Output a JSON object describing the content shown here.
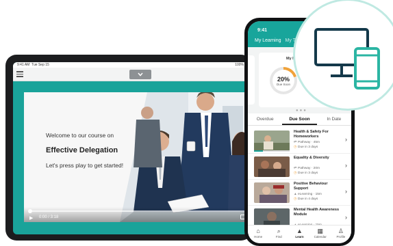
{
  "tablet": {
    "status_time": "9:41 AM",
    "status_date": "Tue Sep 15",
    "status_battery": "100%",
    "collapse_icon": "chevron-down-icon",
    "video": {
      "welcome": "Welcome to our course on",
      "course_title": "Effective Delegation",
      "cta": "Let's press play to get started!",
      "time": "0:00 / 3:18",
      "progress_fraction": 0
    }
  },
  "phone": {
    "status_time": "9:41",
    "tabs": {
      "active": "My Learning",
      "partial": "My T"
    },
    "progress_card": {
      "title": "My Mo",
      "percent": "20%",
      "label": "Due Soon"
    },
    "filter_tabs": [
      {
        "label": "Overdue",
        "active": false
      },
      {
        "label": "Due Soon",
        "active": true
      },
      {
        "label": "In Date",
        "active": false
      }
    ],
    "courses": [
      {
        "title": "Health & Safety For Homeworkers",
        "type": "Pathway · 45m",
        "due": "Due in 3 days",
        "progress": 0.25
      },
      {
        "title": "Equality & Diversity",
        "type": "Pathway · 20m",
        "due": "Due in 3 days",
        "progress": 0
      },
      {
        "title": "Positive Behaviour Support",
        "type": "eLearning · 15m",
        "due": "Due in 4 days",
        "progress": 0
      },
      {
        "title": "Mental Health Awareness Module",
        "type": "eLearning · 15m",
        "due": "",
        "progress": 0
      }
    ],
    "nav": [
      {
        "label": "Home",
        "icon": "home-icon",
        "glyph": "⌂",
        "active": false
      },
      {
        "label": "Find",
        "icon": "search-icon",
        "glyph": "⌕",
        "active": false
      },
      {
        "label": "Learn",
        "icon": "graduation-cap-icon",
        "glyph": "🎓",
        "active": true
      },
      {
        "label": "Calendar",
        "icon": "calendar-icon",
        "glyph": "▦",
        "active": false
      },
      {
        "label": "Profile",
        "icon": "profile-icon",
        "glyph": "♙",
        "active": false
      }
    ]
  },
  "badge": {
    "icon": "desktop-and-mobile-icon",
    "stroke_dark": "#14394a",
    "stroke_accent": "#2bb5a3"
  },
  "colors": {
    "teal": "#18a59b",
    "orange": "#f0a23a",
    "dark": "#1c1d1f"
  }
}
